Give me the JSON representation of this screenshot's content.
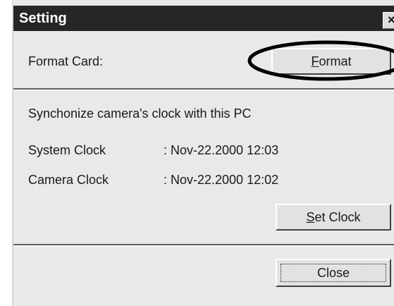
{
  "window": {
    "title": "Setting",
    "close_glyph": "×"
  },
  "format_section": {
    "label": "Format Card:",
    "button_label": "Format",
    "button_mnemonic": "F"
  },
  "clock_section": {
    "heading": "Synchonize camera's clock with this PC",
    "system_clock_label": "System Clock",
    "system_clock_value": ":  Nov-22.2000 12:03",
    "camera_clock_label": "Camera Clock",
    "camera_clock_value": ":  Nov-22.2000 12:02",
    "set_clock_label": "Set Clock",
    "set_clock_mnemonic": "S"
  },
  "footer": {
    "close_label": "Close"
  },
  "annotation": {
    "highlight_target": "format-button",
    "color": "#000000"
  }
}
